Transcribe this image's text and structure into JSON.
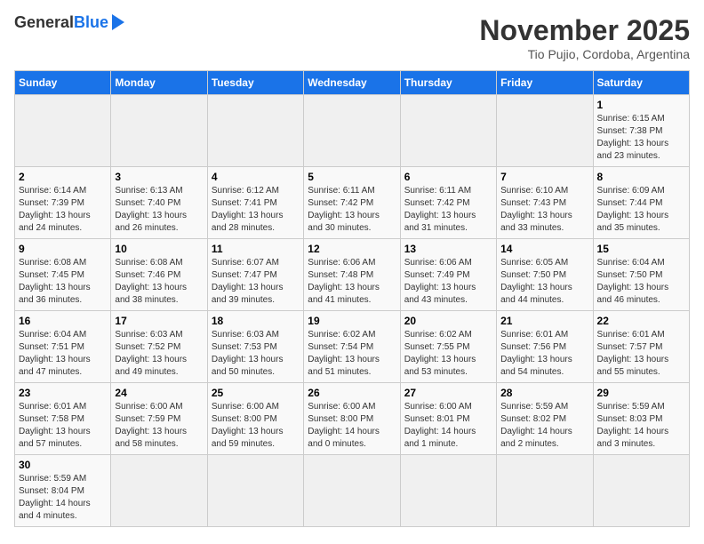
{
  "header": {
    "logo_general": "General",
    "logo_blue": "Blue",
    "month_title": "November 2025",
    "location": "Tio Pujio, Cordoba, Argentina"
  },
  "weekdays": [
    "Sunday",
    "Monday",
    "Tuesday",
    "Wednesday",
    "Thursday",
    "Friday",
    "Saturday"
  ],
  "days": [
    {
      "num": "",
      "info": ""
    },
    {
      "num": "",
      "info": ""
    },
    {
      "num": "",
      "info": ""
    },
    {
      "num": "",
      "info": ""
    },
    {
      "num": "",
      "info": ""
    },
    {
      "num": "",
      "info": ""
    },
    {
      "num": "1",
      "info": "Sunrise: 6:15 AM\nSunset: 7:38 PM\nDaylight: 13 hours\nand 23 minutes."
    },
    {
      "num": "2",
      "info": "Sunrise: 6:14 AM\nSunset: 7:39 PM\nDaylight: 13 hours\nand 24 minutes."
    },
    {
      "num": "3",
      "info": "Sunrise: 6:13 AM\nSunset: 7:40 PM\nDaylight: 13 hours\nand 26 minutes."
    },
    {
      "num": "4",
      "info": "Sunrise: 6:12 AM\nSunset: 7:41 PM\nDaylight: 13 hours\nand 28 minutes."
    },
    {
      "num": "5",
      "info": "Sunrise: 6:11 AM\nSunset: 7:42 PM\nDaylight: 13 hours\nand 30 minutes."
    },
    {
      "num": "6",
      "info": "Sunrise: 6:11 AM\nSunset: 7:42 PM\nDaylight: 13 hours\nand 31 minutes."
    },
    {
      "num": "7",
      "info": "Sunrise: 6:10 AM\nSunset: 7:43 PM\nDaylight: 13 hours\nand 33 minutes."
    },
    {
      "num": "8",
      "info": "Sunrise: 6:09 AM\nSunset: 7:44 PM\nDaylight: 13 hours\nand 35 minutes."
    },
    {
      "num": "9",
      "info": "Sunrise: 6:08 AM\nSunset: 7:45 PM\nDaylight: 13 hours\nand 36 minutes."
    },
    {
      "num": "10",
      "info": "Sunrise: 6:08 AM\nSunset: 7:46 PM\nDaylight: 13 hours\nand 38 minutes."
    },
    {
      "num": "11",
      "info": "Sunrise: 6:07 AM\nSunset: 7:47 PM\nDaylight: 13 hours\nand 39 minutes."
    },
    {
      "num": "12",
      "info": "Sunrise: 6:06 AM\nSunset: 7:48 PM\nDaylight: 13 hours\nand 41 minutes."
    },
    {
      "num": "13",
      "info": "Sunrise: 6:06 AM\nSunset: 7:49 PM\nDaylight: 13 hours\nand 43 minutes."
    },
    {
      "num": "14",
      "info": "Sunrise: 6:05 AM\nSunset: 7:50 PM\nDaylight: 13 hours\nand 44 minutes."
    },
    {
      "num": "15",
      "info": "Sunrise: 6:04 AM\nSunset: 7:50 PM\nDaylight: 13 hours\nand 46 minutes."
    },
    {
      "num": "16",
      "info": "Sunrise: 6:04 AM\nSunset: 7:51 PM\nDaylight: 13 hours\nand 47 minutes."
    },
    {
      "num": "17",
      "info": "Sunrise: 6:03 AM\nSunset: 7:52 PM\nDaylight: 13 hours\nand 49 minutes."
    },
    {
      "num": "18",
      "info": "Sunrise: 6:03 AM\nSunset: 7:53 PM\nDaylight: 13 hours\nand 50 minutes."
    },
    {
      "num": "19",
      "info": "Sunrise: 6:02 AM\nSunset: 7:54 PM\nDaylight: 13 hours\nand 51 minutes."
    },
    {
      "num": "20",
      "info": "Sunrise: 6:02 AM\nSunset: 7:55 PM\nDaylight: 13 hours\nand 53 minutes."
    },
    {
      "num": "21",
      "info": "Sunrise: 6:01 AM\nSunset: 7:56 PM\nDaylight: 13 hours\nand 54 minutes."
    },
    {
      "num": "22",
      "info": "Sunrise: 6:01 AM\nSunset: 7:57 PM\nDaylight: 13 hours\nand 55 minutes."
    },
    {
      "num": "23",
      "info": "Sunrise: 6:01 AM\nSunset: 7:58 PM\nDaylight: 13 hours\nand 57 minutes."
    },
    {
      "num": "24",
      "info": "Sunrise: 6:00 AM\nSunset: 7:59 PM\nDaylight: 13 hours\nand 58 minutes."
    },
    {
      "num": "25",
      "info": "Sunrise: 6:00 AM\nSunset: 8:00 PM\nDaylight: 13 hours\nand 59 minutes."
    },
    {
      "num": "26",
      "info": "Sunrise: 6:00 AM\nSunset: 8:00 PM\nDaylight: 14 hours\nand 0 minutes."
    },
    {
      "num": "27",
      "info": "Sunrise: 6:00 AM\nSunset: 8:01 PM\nDaylight: 14 hours\nand 1 minute."
    },
    {
      "num": "28",
      "info": "Sunrise: 5:59 AM\nSunset: 8:02 PM\nDaylight: 14 hours\nand 2 minutes."
    },
    {
      "num": "29",
      "info": "Sunrise: 5:59 AM\nSunset: 8:03 PM\nDaylight: 14 hours\nand 3 minutes."
    },
    {
      "num": "30",
      "info": "Sunrise: 5:59 AM\nSunset: 8:04 PM\nDaylight: 14 hours\nand 4 minutes."
    },
    {
      "num": "",
      "info": ""
    },
    {
      "num": "",
      "info": ""
    },
    {
      "num": "",
      "info": ""
    },
    {
      "num": "",
      "info": ""
    },
    {
      "num": "",
      "info": ""
    },
    {
      "num": "",
      "info": ""
    }
  ]
}
